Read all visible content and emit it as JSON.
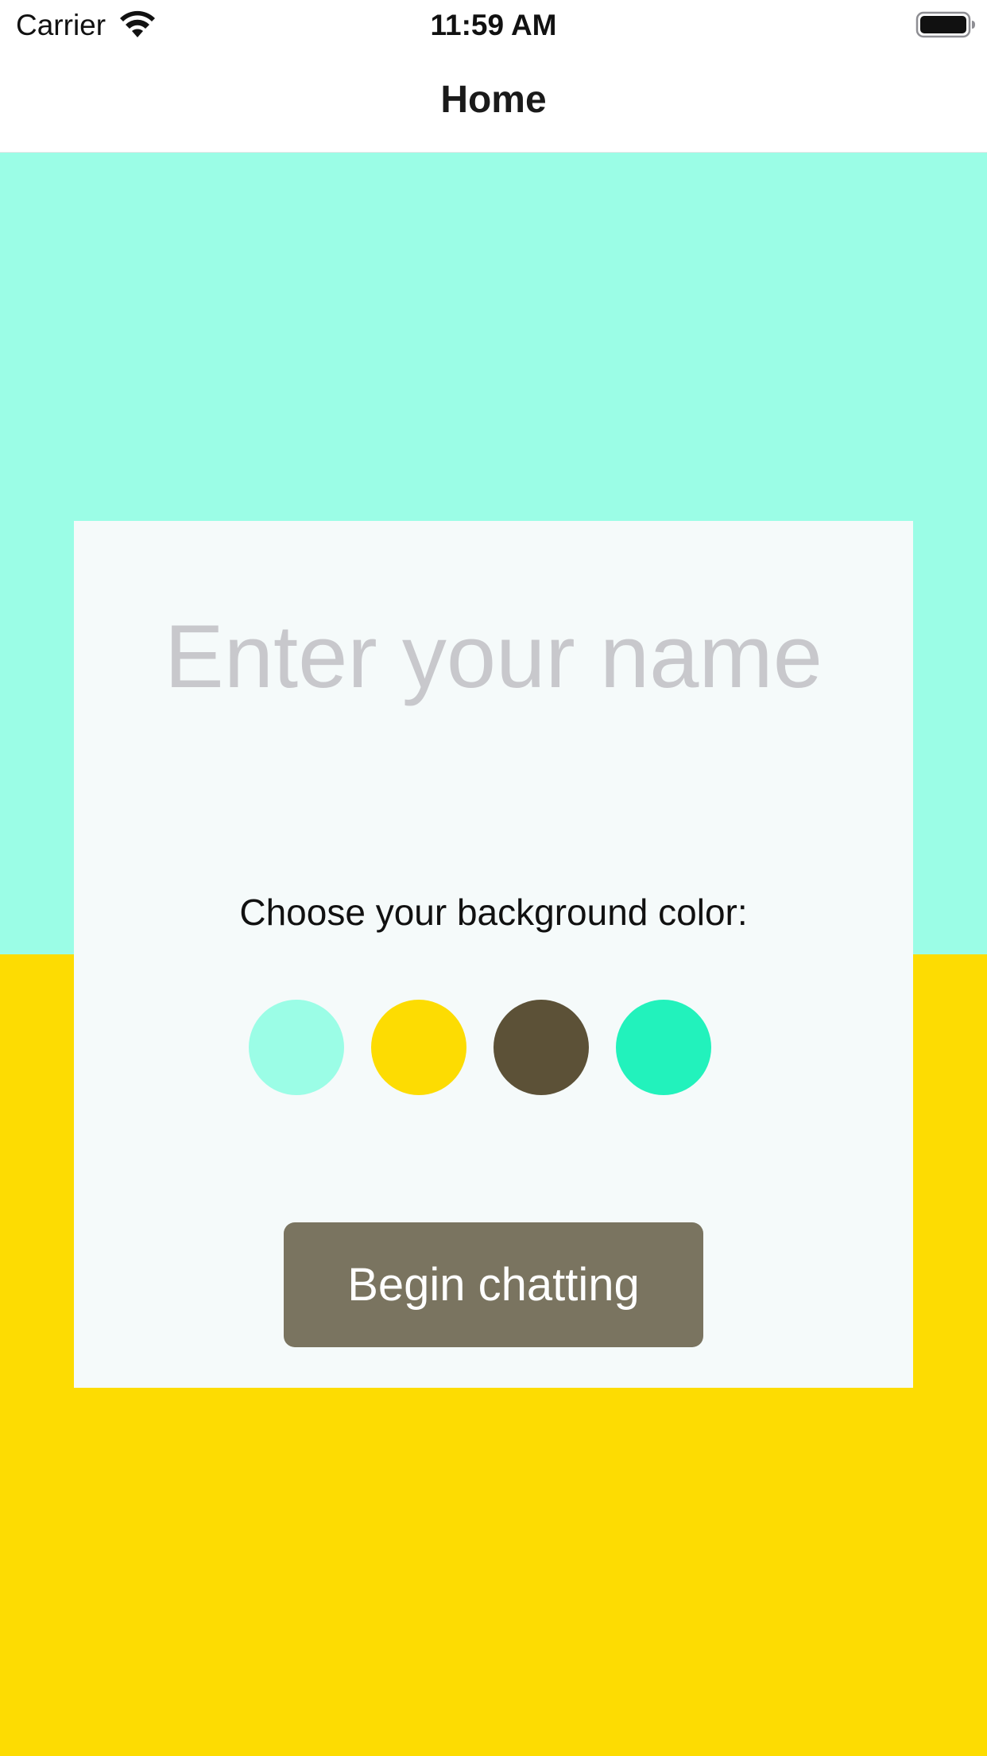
{
  "status_bar": {
    "carrier": "Carrier",
    "time": "11:59 AM",
    "wifi_icon": "wifi-icon",
    "battery_icon": "battery-icon"
  },
  "nav": {
    "title": "Home"
  },
  "background": {
    "top_color": "#9bfde6",
    "bottom_color": "#fddc02"
  },
  "card": {
    "name_placeholder": "Enter your name",
    "name_value": "",
    "color_label": "Choose your background color:",
    "swatches": [
      {
        "name": "aquamarine",
        "color": "#9bfde6"
      },
      {
        "name": "yellow",
        "color": "#fddc02"
      },
      {
        "name": "dark-olive",
        "color": "#5c5137"
      },
      {
        "name": "turquoise",
        "color": "#22f2bc"
      }
    ],
    "begin_button": {
      "label": "Begin chatting",
      "color": "#7a7460"
    }
  }
}
